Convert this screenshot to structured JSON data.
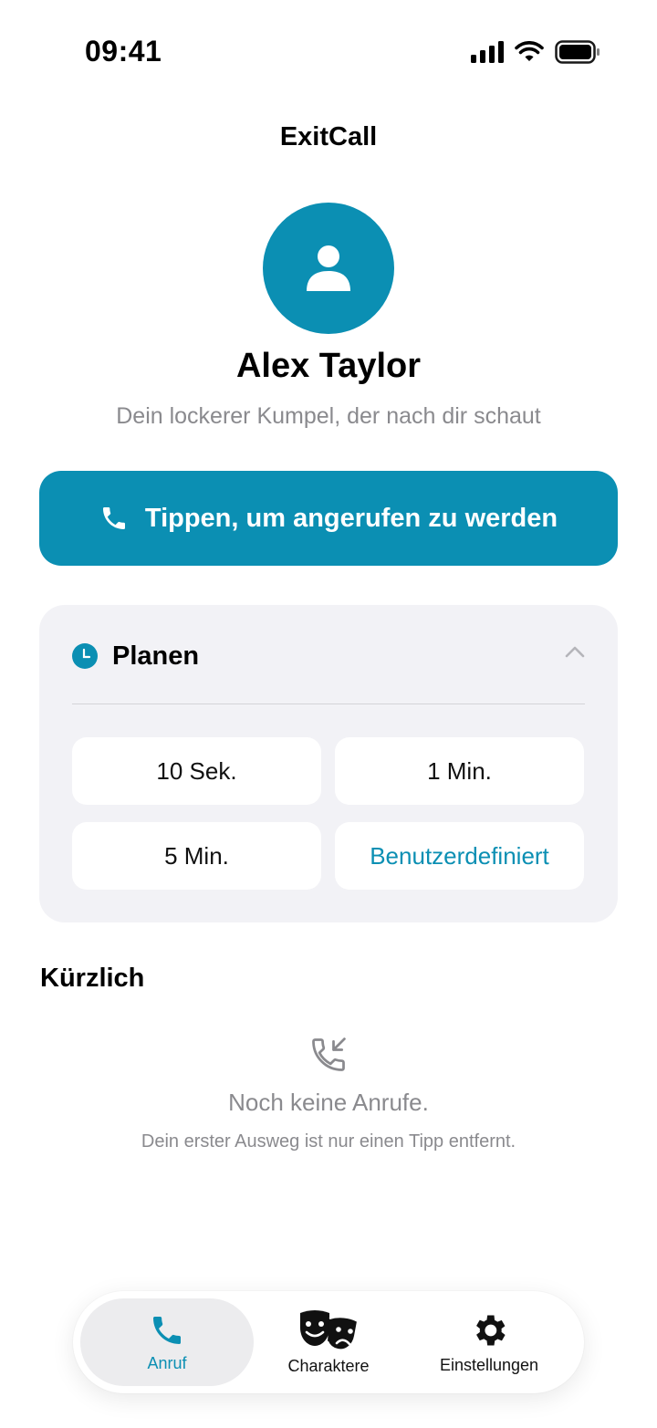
{
  "status_bar": {
    "time": "09:41"
  },
  "app": {
    "title": "ExitCall"
  },
  "contact": {
    "name": "Alex Taylor",
    "subtitle": "Dein lockerer Kumpel, der nach dir schaut",
    "avatar_icon": "person-icon"
  },
  "call_button": {
    "label": "Tippen, um angerufen zu werden",
    "icon": "phone-icon"
  },
  "schedule": {
    "title": "Planen",
    "icon": "clock-icon",
    "expanded": true,
    "presets": [
      "10 Sek.",
      "1 Min.",
      "5 Min.",
      "Benutzerdefiniert"
    ]
  },
  "recent": {
    "title": "Kürzlich",
    "empty_title": "Noch keine Anrufe.",
    "empty_subtitle": "Dein erster Ausweg ist nur einen Tipp entfernt.",
    "empty_icon": "incoming-call-icon"
  },
  "tabs": [
    {
      "label": "Anruf",
      "icon": "phone-icon",
      "active": true
    },
    {
      "label": "Charaktere",
      "icon": "theater-masks-icon",
      "active": false
    },
    {
      "label": "Einstellungen",
      "icon": "gear-icon",
      "active": false
    }
  ],
  "colors": {
    "accent": "#0b8fb3",
    "card_bg": "#f2f2f6",
    "secondary_text": "#8a8a8e"
  }
}
